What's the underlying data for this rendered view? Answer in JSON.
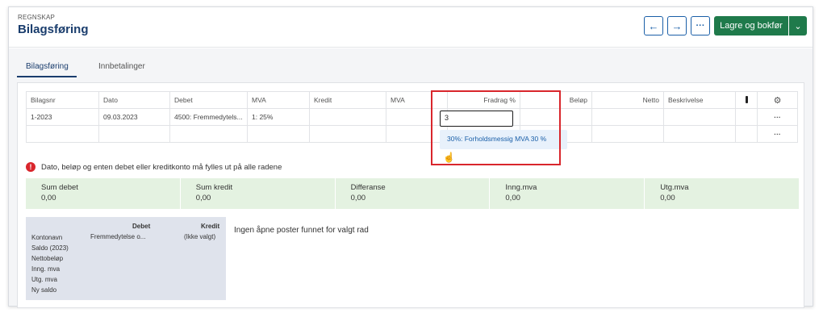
{
  "header": {
    "breadcrumb": "REGNSKAP",
    "title": "Bilagsføring",
    "primary_label": "Lagre og bokfør"
  },
  "tabs": [
    "Bilagsføring",
    "Innbetalinger"
  ],
  "grid": {
    "headers": [
      "Bilagsnr",
      "Dato",
      "Debet",
      "MVA",
      "Kredit",
      "MVA",
      "Fradrag %",
      "Beløp",
      "Netto",
      "Beskrivelse"
    ],
    "row1": {
      "bilagsnr": "1-2023",
      "dato": "09.03.2023",
      "debet": "4500: Fremmedytels...",
      "mva": "1: 25%"
    },
    "fradrag_input": "3",
    "dropdown_option": "30%: Forholdsmessig MVA 30 %"
  },
  "error": "Dato, beløp og enten debet eller kreditkonto må fylles ut på alle radene",
  "sums": [
    {
      "label": "Sum debet",
      "value": "0,00"
    },
    {
      "label": "Sum kredit",
      "value": "0,00"
    },
    {
      "label": "Differanse",
      "value": "0,00"
    },
    {
      "label": "Inng.mva",
      "value": "0,00"
    },
    {
      "label": "Utg.mva",
      "value": "0,00"
    }
  ],
  "account": {
    "debet_header": "Debet",
    "kredit_header": "Kredit",
    "rows": [
      "Kontonavn",
      "Saldo (2023)",
      "Nettobeløp",
      "Inng. mva",
      "Utg. mva",
      "Ny saldo"
    ],
    "debet_value": "Fremmedytelse o...",
    "kredit_value": "(Ikke valgt)"
  },
  "no_posts": "Ingen åpne poster funnet for valgt rad",
  "colors": {
    "primary": "#1f7a4b",
    "accent": "#1a5fa8",
    "error": "#d9262c",
    "sum_bg": "#e4f2e1"
  }
}
